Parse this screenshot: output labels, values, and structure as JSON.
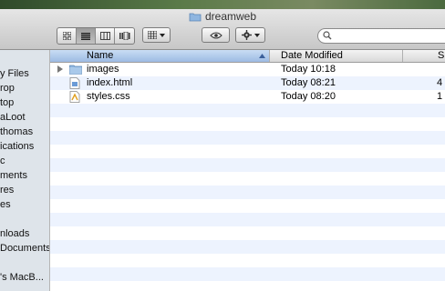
{
  "window": {
    "title": "dreamweb"
  },
  "toolbar": {
    "view_buttons": [
      "icon-view",
      "list-view",
      "column-view",
      "coverflow-view"
    ],
    "arrange_icon": "arrange-grid-icon",
    "quicklook_icon": "eye-icon",
    "action_icon": "gear-icon",
    "search": {
      "value": "",
      "placeholder": ""
    }
  },
  "sidebar": {
    "items": [
      "y Files",
      "rop",
      "top",
      "aLoot",
      "thomas",
      "ications",
      "c",
      "ments",
      "res",
      "es",
      "nloads",
      "Documents",
      "'s MacB..."
    ]
  },
  "columns": {
    "name": "Name",
    "date": "Date Modified",
    "size": "S"
  },
  "files": [
    {
      "name": "images",
      "date": "Today 10:18",
      "size": "",
      "kind": "folder"
    },
    {
      "name": "index.html",
      "date": "Today 08:21",
      "size": "4",
      "kind": "html"
    },
    {
      "name": "styles.css",
      "date": "Today 08:20",
      "size": "1",
      "kind": "css"
    }
  ],
  "colors": {
    "sorted_header": "#9dbbe3",
    "stripe": "#edf3fe",
    "sidebar_bg": "#dee4ea"
  }
}
